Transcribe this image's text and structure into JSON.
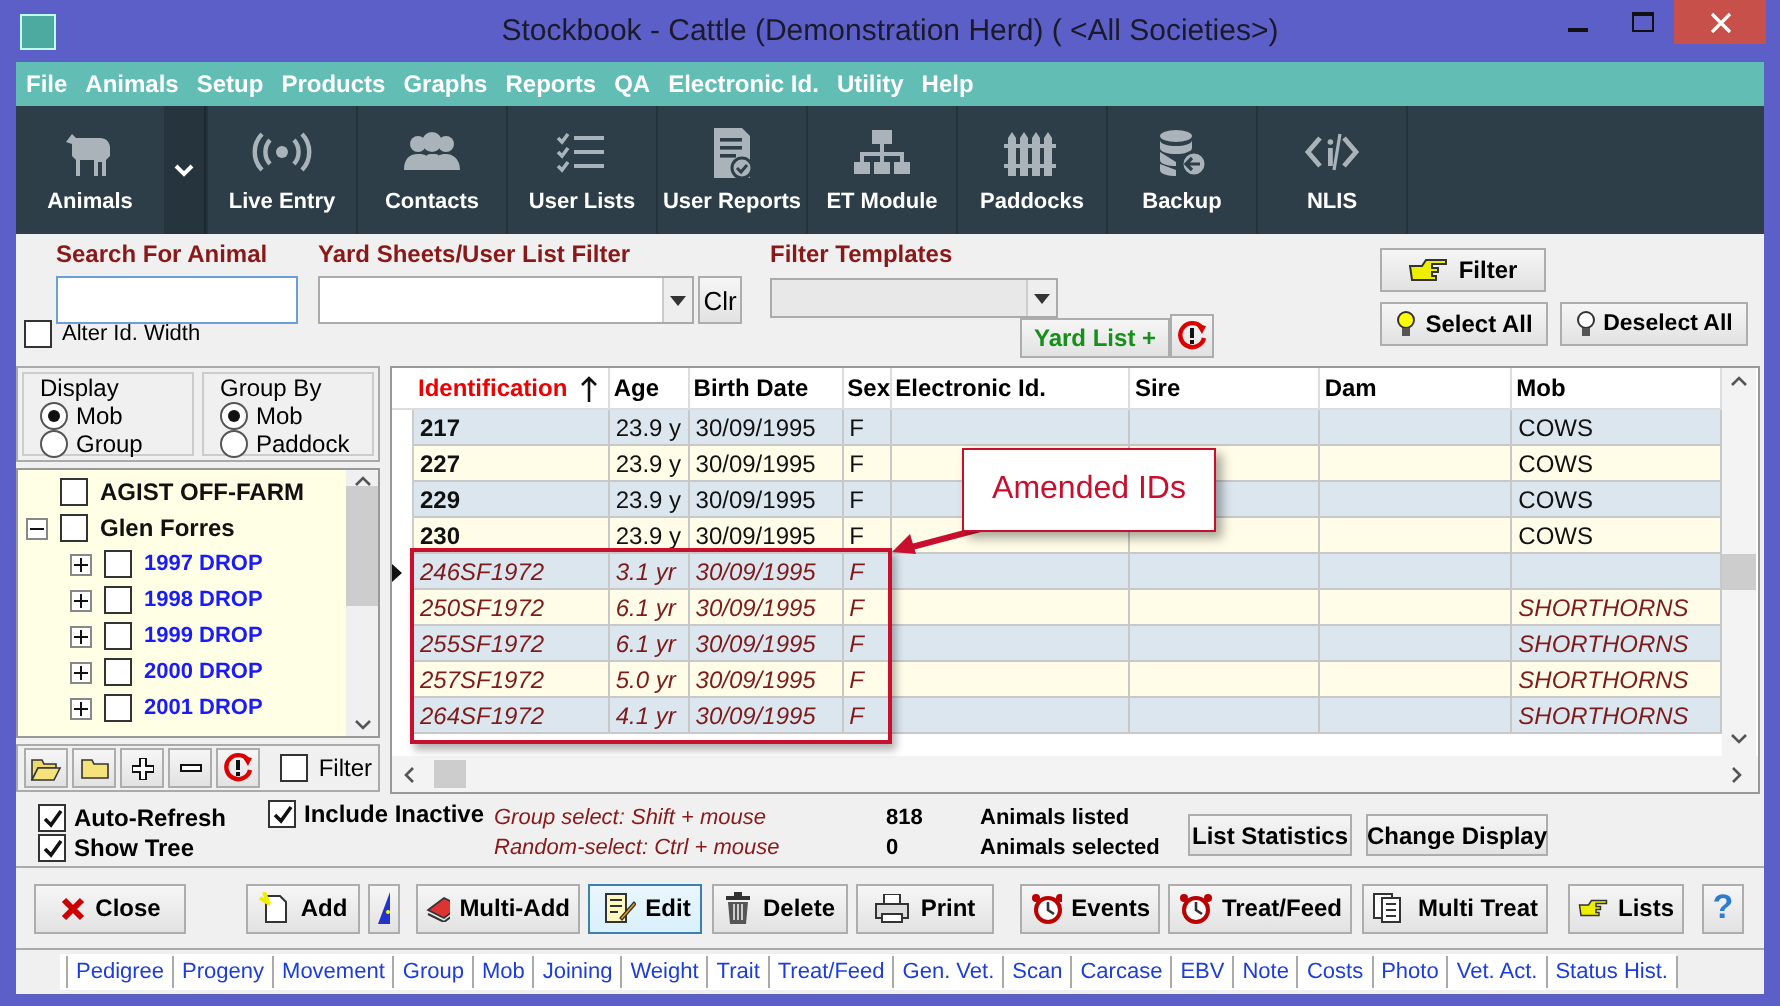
{
  "window": {
    "title": "Stockbook - Cattle (Demonstration Herd) ( <All Societies>)"
  },
  "menu": [
    "File",
    "Animals",
    "Setup",
    "Products",
    "Graphs",
    "Reports",
    "QA",
    "Electronic Id.",
    "Utility",
    "Help"
  ],
  "toolbar": [
    {
      "label": "Animals",
      "has_dropdown": true
    },
    {
      "label": "Live Entry",
      "has_dropdown": false
    },
    {
      "label": "Contacts",
      "has_dropdown": false
    },
    {
      "label": "User Lists",
      "has_dropdown": false
    },
    {
      "label": "User Reports",
      "has_dropdown": false
    },
    {
      "label": "ET Module",
      "has_dropdown": false
    },
    {
      "label": "Paddocks",
      "has_dropdown": false
    },
    {
      "label": "Backup",
      "has_dropdown": false
    },
    {
      "label": "NLIS",
      "has_dropdown": false
    }
  ],
  "filters": {
    "search": {
      "label": "Search For Animal"
    },
    "yard_sheets": {
      "label": "Yard Sheets/User List Filter",
      "clear_button": "Clr"
    },
    "filter_templates": {
      "label": "Filter Templates"
    },
    "alter_id_width": {
      "label": "Alter Id. Width",
      "checked": false
    },
    "yard_list_button": "Yard List +",
    "filter_button": "Filter",
    "select_all_button": "Select All",
    "deselect_all_button": "Deselect All"
  },
  "display": {
    "title": "Display",
    "options": [
      {
        "label": "Mob",
        "selected": true
      },
      {
        "label": "Group",
        "selected": false
      }
    ]
  },
  "group_by": {
    "title": "Group By",
    "options": [
      {
        "label": "Mob",
        "selected": true
      },
      {
        "label": "Paddock",
        "selected": false
      }
    ]
  },
  "tree": {
    "items": [
      {
        "label": "AGIST OFF-FARM",
        "checked": false
      },
      {
        "label": "Glen Forres",
        "checked": false,
        "expanded": true,
        "children": [
          {
            "label": "1997 DROP",
            "checked": false,
            "expanded": false
          },
          {
            "label": "1998 DROP",
            "checked": false,
            "expanded": false
          },
          {
            "label": "1999 DROP",
            "checked": false,
            "expanded": false
          },
          {
            "label": "2000 DROP",
            "checked": false,
            "expanded": false
          },
          {
            "label": "2001 DROP",
            "checked": false,
            "expanded": false
          }
        ]
      }
    ],
    "filter_checkbox": {
      "label": "Filter",
      "checked": false
    }
  },
  "table": {
    "columns": [
      {
        "label": "Identification",
        "sorted": true
      },
      {
        "label": "Age",
        "sorted": false
      },
      {
        "label": "Birth Date",
        "sorted": false
      },
      {
        "label": "Sex",
        "sorted": false
      },
      {
        "label": "Electronic Id.",
        "sorted": false
      },
      {
        "label": "Sire",
        "sorted": false
      },
      {
        "label": "Dam",
        "sorted": false
      },
      {
        "label": "Mob",
        "sorted": false
      }
    ],
    "rows": [
      {
        "identification": "217",
        "age": "23.9 y",
        "birth_date": "30/09/1995",
        "sex": "F",
        "mob": "COWS",
        "amended": false,
        "current": false
      },
      {
        "identification": "227",
        "age": "23.9 y",
        "birth_date": "30/09/1995",
        "sex": "F",
        "mob": "COWS",
        "amended": false,
        "current": false
      },
      {
        "identification": "229",
        "age": "23.9 y",
        "birth_date": "30/09/1995",
        "sex": "F",
        "mob": "COWS",
        "amended": false,
        "current": false
      },
      {
        "identification": "230",
        "age": "23.9 y",
        "birth_date": "30/09/1995",
        "sex": "F",
        "mob": "COWS",
        "amended": false,
        "current": false
      },
      {
        "identification": "246SF1972",
        "age": "3.1 yr",
        "birth_date": "30/09/1995",
        "sex": "F",
        "amended": true,
        "current": true
      },
      {
        "identification": "250SF1972",
        "age": "6.1 yr",
        "birth_date": "30/09/1995",
        "sex": "F",
        "mob": "SHORTHORNS",
        "amended": true,
        "current": false
      },
      {
        "identification": "255SF1972",
        "age": "6.1 yr",
        "birth_date": "30/09/1995",
        "sex": "F",
        "mob": "SHORTHORNS",
        "amended": true,
        "current": false
      },
      {
        "identification": "257SF1972",
        "age": "5.0 yr",
        "birth_date": "30/09/1995",
        "sex": "F",
        "mob": "SHORTHORNS",
        "amended": true,
        "current": false
      },
      {
        "identification": "264SF1972",
        "age": "4.1 yr",
        "birth_date": "30/09/1995",
        "sex": "F",
        "mob": "SHORTHORNS",
        "amended": true,
        "current": false
      }
    ],
    "annotation": {
      "text": "Amended IDs"
    }
  },
  "options": {
    "checkboxes": [
      {
        "label": "Auto-Refresh",
        "checked": true
      },
      {
        "label": "Show Tree",
        "checked": true
      },
      {
        "label": "Include Inactive",
        "checked": true
      }
    ],
    "hints": [
      "Group select: Shift + mouse",
      "Random-select: Ctrl + mouse"
    ],
    "counts": [
      {
        "value": "818",
        "label": "Animals listed"
      },
      {
        "value": "0",
        "label": "Animals selected"
      }
    ],
    "buttons": [
      "List Statistics",
      "Change Display"
    ]
  },
  "actions": [
    {
      "kind": "close",
      "label": "Close",
      "selected": false
    },
    {
      "kind": "add",
      "label": "Add",
      "selected": false
    },
    {
      "kind": "wizard",
      "selected": false
    },
    {
      "kind": "multiadd",
      "label": "Multi-Add",
      "selected": false
    },
    {
      "kind": "edit",
      "label": "Edit",
      "selected": true
    },
    {
      "kind": "delete",
      "label": "Delete",
      "selected": false
    },
    {
      "kind": "print",
      "label": "Print",
      "selected": false
    },
    {
      "kind": "events",
      "label": "Events",
      "selected": false
    },
    {
      "kind": "treat",
      "label": "Treat/Feed",
      "selected": false
    },
    {
      "kind": "multitreat",
      "label": "Multi Treat",
      "selected": false
    },
    {
      "kind": "lists",
      "label": "Lists",
      "selected": false
    },
    {
      "kind": "help",
      "label": "?",
      "selected": false
    }
  ],
  "links": [
    "Pedigree",
    "Progeny",
    "Movement",
    "Group",
    "Mob",
    "Joining",
    "Weight",
    "Trait",
    "Treat/Feed",
    "Gen. Vet.",
    "Scan",
    "Carcase",
    "EBV",
    "Note",
    "Costs",
    "Photo",
    "Vet. Act.",
    "Status Hist."
  ]
}
